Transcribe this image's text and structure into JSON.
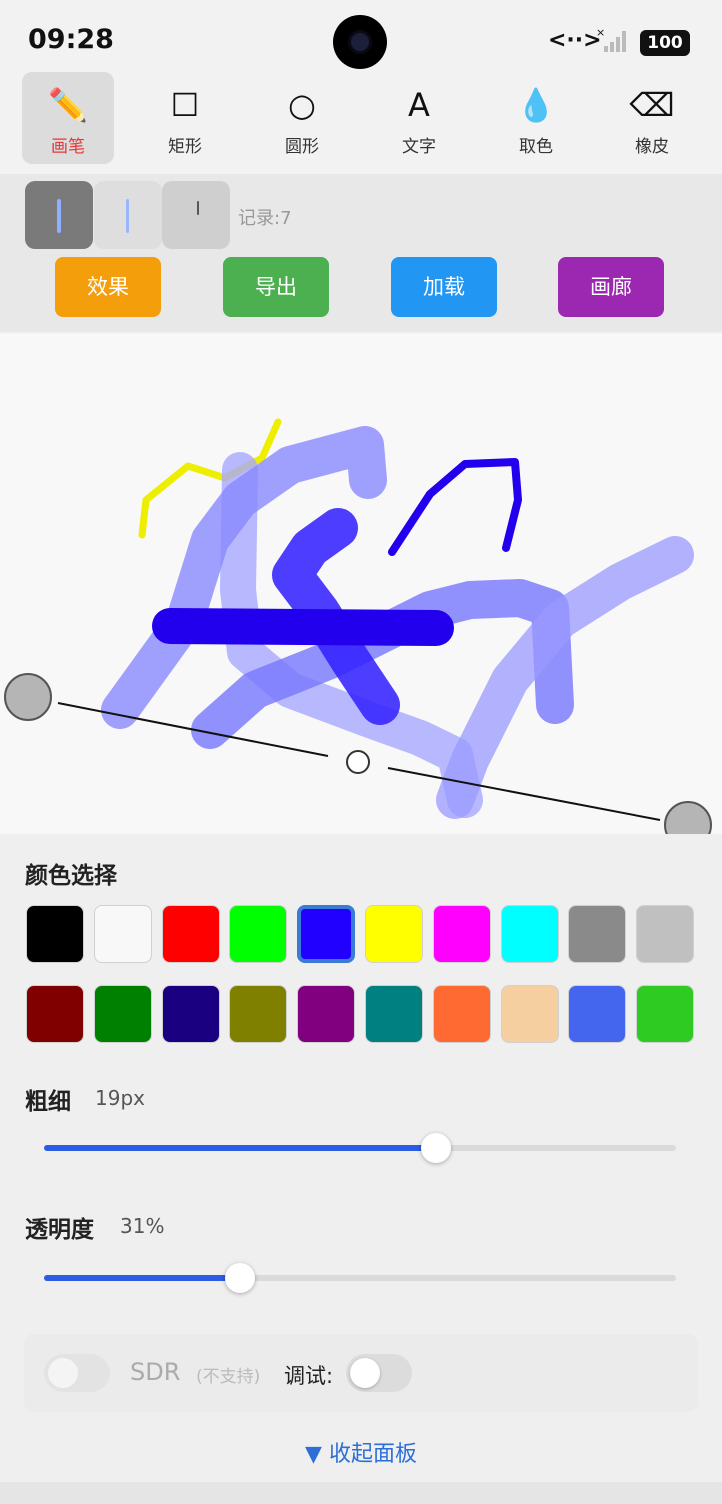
{
  "status_bar": {
    "time": "09:28",
    "net_icon": "<··>",
    "battery": "100"
  },
  "toolbar": [
    {
      "label": "画笔",
      "icon": "pencil-icon",
      "glyph": "✏️",
      "active": true
    },
    {
      "label": "矩形",
      "icon": "rectangle-icon",
      "glyph": "☐",
      "active": false
    },
    {
      "label": "圆形",
      "icon": "circle-icon",
      "glyph": "○",
      "active": false
    },
    {
      "label": "文字",
      "icon": "text-icon",
      "glyph": "A",
      "active": false
    },
    {
      "label": "取色",
      "icon": "dropper-icon",
      "glyph": "💧",
      "active": false
    },
    {
      "label": "橡皮",
      "icon": "eraser-icon",
      "glyph": "⌫",
      "active": false
    }
  ],
  "history": {
    "label": "记录:7"
  },
  "actions": [
    {
      "label": "效果",
      "color": "#f59e0b"
    },
    {
      "label": "导出",
      "color": "#4caf50"
    },
    {
      "label": "加载",
      "color": "#2196f3"
    },
    {
      "label": "画廊",
      "color": "#9c27b0"
    }
  ],
  "colors": {
    "title": "颜色选择",
    "row1": [
      "#000000",
      "#f8f8f8",
      "#ff0000",
      "#00ff00",
      "#2200ff",
      "#ffff00",
      "#ff00ff",
      "#00ffff",
      "#8a8a8a",
      "#c0c0c0"
    ],
    "row2": [
      "#800000",
      "#008000",
      "#1a0080",
      "#808000",
      "#800080",
      "#008080",
      "#ff6a33",
      "#f5cfa0",
      "#4466ee",
      "#2ecc22"
    ],
    "selected": "#2200ff"
  },
  "size": {
    "label": "粗细",
    "value_text": "19px",
    "fraction": 0.62
  },
  "opacity": {
    "label": "透明度",
    "value_text": "31%",
    "fraction": 0.31
  },
  "sdr": {
    "label": "SDR",
    "note": "(不支持)",
    "enabled": false
  },
  "debug": {
    "label": "调试:",
    "enabled": false
  },
  "collapse": {
    "label": "▼ 收起面板"
  }
}
